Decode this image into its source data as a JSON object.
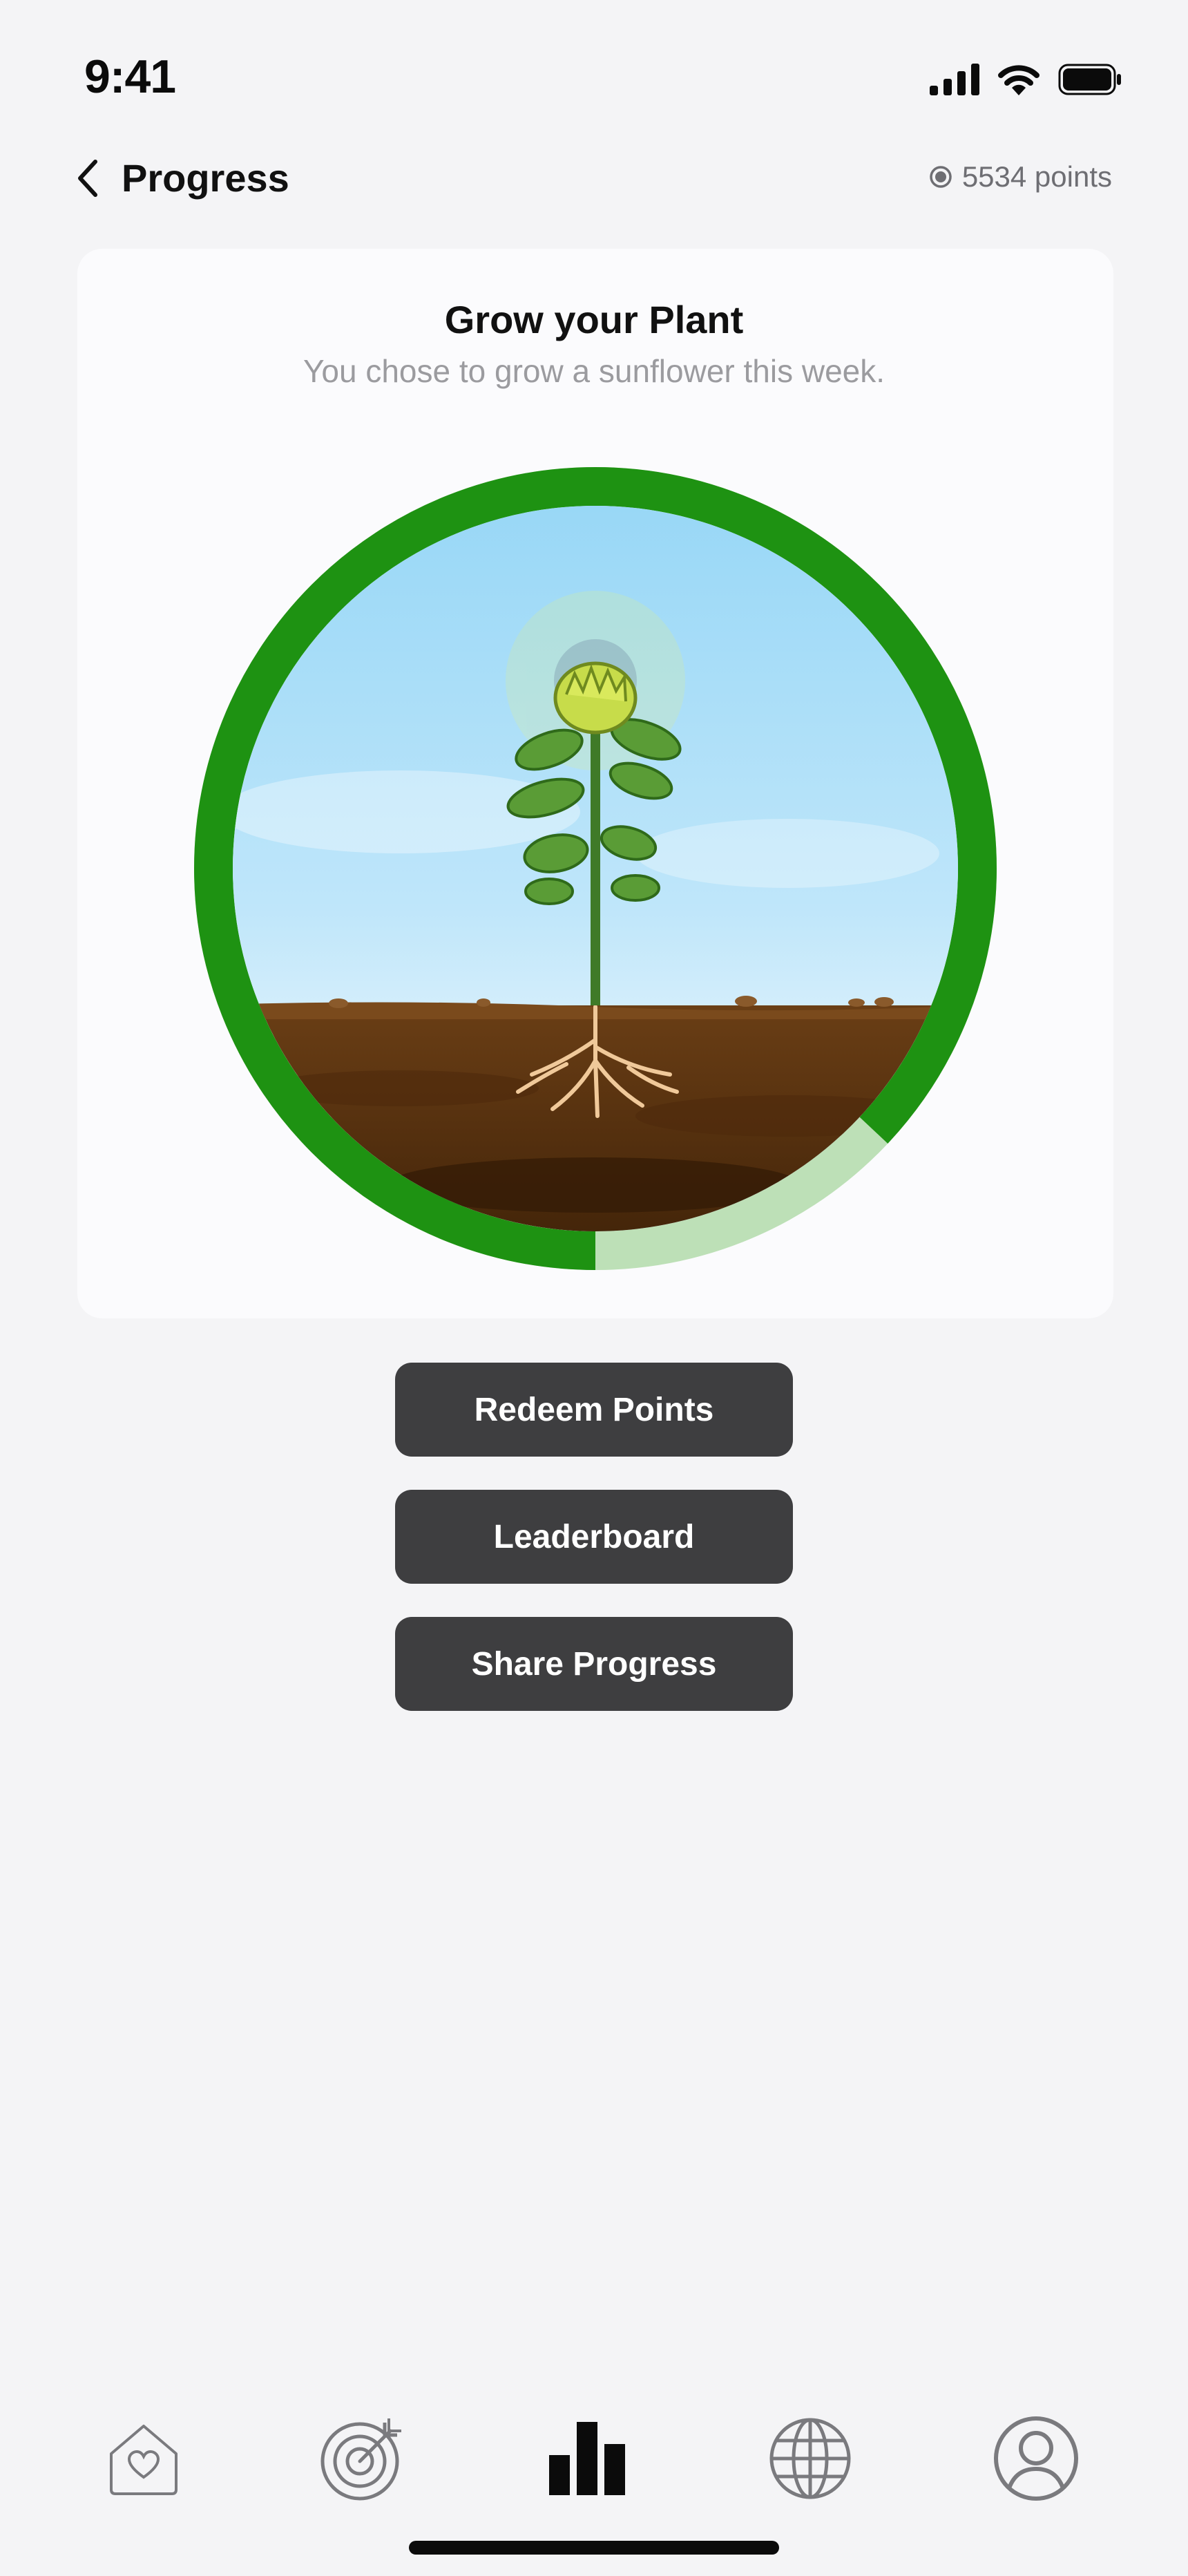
{
  "status_bar": {
    "time": "9:41",
    "icons": [
      "cellular-signal-icon",
      "wifi-icon",
      "battery-icon"
    ]
  },
  "header": {
    "back_icon": "chevron-left-icon",
    "title": "Progress",
    "points_icon": "points-dot-icon",
    "points_label": "5534 points"
  },
  "plant_card": {
    "title": "Grow your Plant",
    "subtitle": "You chose to grow a sunflower this week.",
    "plant": "sunflower",
    "progress_fraction": 0.87,
    "colors": {
      "ring": "#1e9212",
      "ring_remaining": "#bde0b7",
      "sky": "#a9dcf7",
      "soil": "#5a3411"
    }
  },
  "actions": {
    "redeem": "Redeem Points",
    "leaderboard": "Leaderboard",
    "share": "Share Progress"
  },
  "tab_bar": {
    "tabs": [
      {
        "icon": "home-heart-icon",
        "active": false
      },
      {
        "icon": "target-icon",
        "active": false
      },
      {
        "icon": "bar-chart-icon",
        "active": true
      },
      {
        "icon": "globe-icon",
        "active": false
      },
      {
        "icon": "profile-icon",
        "active": false
      }
    ]
  }
}
